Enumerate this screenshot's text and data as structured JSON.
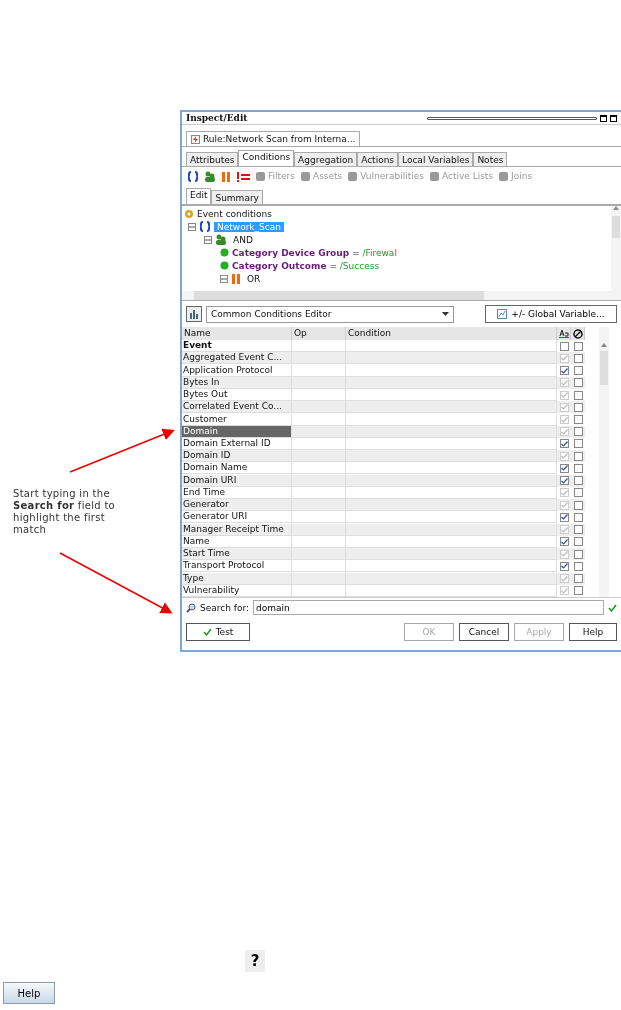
{
  "annotation": {
    "text": "Start typing in the **Search for** field to highlight the first match"
  },
  "window": {
    "title": "Inspect/Edit",
    "document_tab": "Rule:Network Scan from Interna...",
    "tabs": [
      {
        "label": "Attributes",
        "selected": false
      },
      {
        "label": "Conditions",
        "selected": true
      },
      {
        "label": "Aggregation",
        "selected": false
      },
      {
        "label": "Actions",
        "selected": false
      },
      {
        "label": "Local Variables",
        "selected": false
      },
      {
        "label": "Notes",
        "selected": false
      }
    ],
    "toolbar": [
      {
        "kind": "braces"
      },
      {
        "kind": "and"
      },
      {
        "kind": "or"
      },
      {
        "kind": "not"
      },
      {
        "kind": "tool",
        "label": "Filters"
      },
      {
        "kind": "tool",
        "label": "Assets"
      },
      {
        "kind": "tool",
        "label": "Vulnerabilities"
      },
      {
        "kind": "tool",
        "label": "Active Lists"
      },
      {
        "kind": "tool",
        "label": "Joins"
      }
    ],
    "subtabs": [
      {
        "label": "Edit",
        "selected": true
      },
      {
        "label": "Summary",
        "selected": false
      }
    ],
    "tree": {
      "label": "Event conditions",
      "children": [
        {
          "kind": "braces",
          "label": "Network_Scan",
          "selected": true,
          "expanded": true,
          "children": [
            {
              "kind": "and",
              "label": "AND",
              "selected": false,
              "expanded": true,
              "children": [
                {
                  "kind": "condition",
                  "field": "Category Device Group",
                  "op": "=",
                  "value": "/Firewal"
                },
                {
                  "kind": "condition",
                  "field": "Category Outcome",
                  "op": "=",
                  "value": "/Success"
                },
                {
                  "kind": "or",
                  "label": "OR",
                  "selected": false,
                  "expanded": true
                }
              ]
            }
          ]
        }
      ]
    },
    "editor": "Common Conditions Editor",
    "global_button": "+/- Global Variable...",
    "columns": [
      "Name",
      "Op",
      "Condition"
    ],
    "rows": [
      {
        "name": "Event",
        "kind": "group",
        "selected": false,
        "checked": false,
        "disabled": false,
        "excluded": false
      },
      {
        "name": "Aggregated Event C...",
        "kind": "field",
        "selected": false,
        "checked": true,
        "disabled": true,
        "excluded": false
      },
      {
        "name": "Application Protocol",
        "kind": "field",
        "selected": false,
        "checked": true,
        "disabled": false,
        "excluded": false
      },
      {
        "name": "Bytes In",
        "kind": "field",
        "selected": false,
        "checked": true,
        "disabled": true,
        "excluded": false
      },
      {
        "name": "Bytes Out",
        "kind": "field",
        "selected": false,
        "checked": true,
        "disabled": true,
        "excluded": false
      },
      {
        "name": "Correlated Event Co...",
        "kind": "field",
        "selected": false,
        "checked": true,
        "disabled": true,
        "excluded": false
      },
      {
        "name": "Customer",
        "kind": "field",
        "selected": false,
        "checked": true,
        "disabled": true,
        "excluded": false
      },
      {
        "name": "Domain",
        "kind": "field",
        "selected": true,
        "checked": true,
        "disabled": true,
        "excluded": false
      },
      {
        "name": "Domain External ID",
        "kind": "field",
        "selected": false,
        "checked": true,
        "disabled": false,
        "excluded": false
      },
      {
        "name": "Domain ID",
        "kind": "field",
        "selected": false,
        "checked": true,
        "disabled": true,
        "excluded": false
      },
      {
        "name": "Domain Name",
        "kind": "field",
        "selected": false,
        "checked": true,
        "disabled": false,
        "excluded": false
      },
      {
        "name": "Domain URI",
        "kind": "field",
        "selected": false,
        "checked": true,
        "disabled": false,
        "excluded": false
      },
      {
        "name": "End Time",
        "kind": "field",
        "selected": false,
        "checked": true,
        "disabled": true,
        "excluded": false
      },
      {
        "name": "Generator",
        "kind": "field",
        "selected": false,
        "checked": true,
        "disabled": true,
        "excluded": false
      },
      {
        "name": "Generator URI",
        "kind": "field",
        "selected": false,
        "checked": true,
        "disabled": false,
        "excluded": false
      },
      {
        "name": "Manager Receipt Time",
        "kind": "field",
        "selected": false,
        "checked": true,
        "disabled": true,
        "excluded": false
      },
      {
        "name": "Name",
        "kind": "field",
        "selected": false,
        "checked": true,
        "disabled": false,
        "excluded": false
      },
      {
        "name": "Start Time",
        "kind": "field",
        "selected": false,
        "checked": true,
        "disabled": true,
        "excluded": false
      },
      {
        "name": "Transport Protocol",
        "kind": "field",
        "selected": false,
        "checked": true,
        "disabled": false,
        "excluded": false
      },
      {
        "name": "Type",
        "kind": "field",
        "selected": false,
        "checked": true,
        "disabled": true,
        "excluded": false
      },
      {
        "name": "Vulnerability",
        "kind": "field",
        "selected": false,
        "checked": true,
        "disabled": true,
        "excluded": false
      }
    ],
    "search": {
      "label": "Search for:",
      "value": "domain"
    },
    "buttons": [
      {
        "label": "Test",
        "disabled": false,
        "kind": "test"
      },
      {
        "label": "OK",
        "disabled": true
      },
      {
        "label": "Cancel",
        "disabled": false
      },
      {
        "label": "Apply",
        "disabled": true
      },
      {
        "label": "Help",
        "disabled": false
      }
    ]
  },
  "help_icon": "?",
  "help_button": "Help"
}
